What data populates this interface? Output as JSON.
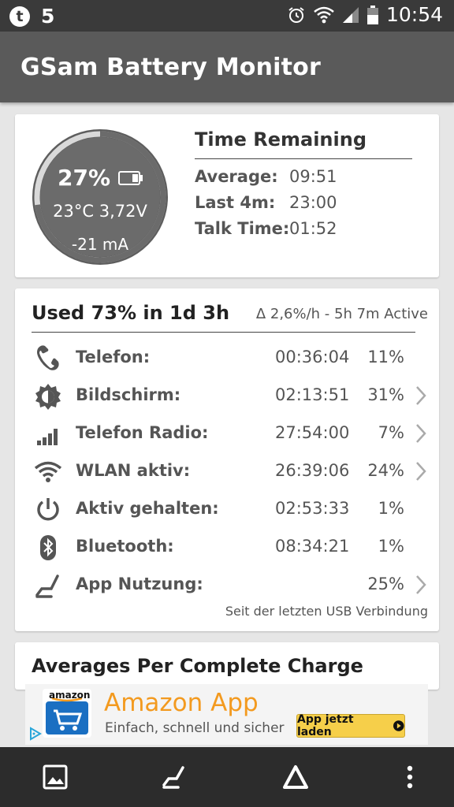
{
  "status_bar": {
    "left_icon": "t",
    "notification_count": "5",
    "time": "10:54",
    "icons": [
      "alarm-icon",
      "wifi-icon",
      "signal-icon",
      "battery-icon"
    ]
  },
  "app_bar": {
    "title": "GSam Battery Monitor"
  },
  "gauge": {
    "percent": "27%",
    "level": 0.27,
    "temp_voltage": "23°C  3,72V",
    "current": "-21 mA"
  },
  "time_remaining": {
    "title": "Time Remaining",
    "rows": [
      {
        "label": "Average:",
        "value": "09:51"
      },
      {
        "label": "Last 4m:",
        "value": "23:00"
      },
      {
        "label": "Talk Time:",
        "value": "01:52"
      }
    ]
  },
  "usage": {
    "title": "Used 73% in 1d 3h",
    "rate": "Δ 2,6%/h - 5h 7m Active",
    "rows": [
      {
        "icon": "phone-icon",
        "label": "Telefon:",
        "time": "00:36:04",
        "percent": "11%",
        "has_chevron": false
      },
      {
        "icon": "brightness-icon",
        "label": "Bildschirm:",
        "time": "02:13:51",
        "percent": "31%",
        "has_chevron": true
      },
      {
        "icon": "signal-bars-icon",
        "label": "Telefon Radio:",
        "time": "27:54:00",
        "percent": "7%",
        "has_chevron": true
      },
      {
        "icon": "wifi-icon",
        "label": "WLAN aktiv:",
        "time": "26:39:06",
        "percent": "24%",
        "has_chevron": true
      },
      {
        "icon": "power-icon",
        "label": "Aktiv gehalten:",
        "time": "02:53:33",
        "percent": "1%",
        "has_chevron": false
      },
      {
        "icon": "bluetooth-icon",
        "label": "Bluetooth:",
        "time": "08:34:21",
        "percent": "1%",
        "has_chevron": false
      },
      {
        "icon": "app-usage-icon",
        "label": "App Nutzung:",
        "time": "",
        "percent": "25%",
        "has_chevron": true
      }
    ],
    "since": "Seit der letzten USB Verbindung"
  },
  "averages": {
    "title": "Averages Per Complete Charge"
  },
  "ad": {
    "brand": "amazon",
    "title": "Amazon App",
    "subtitle": "Einfach, schnell und sicher",
    "button": "App jetzt laden"
  },
  "bottom_nav": [
    "image-icon",
    "app-usage-icon",
    "delta-icon",
    "overflow-menu-icon"
  ],
  "colors": {
    "status_bar": "#3a3a3a",
    "app_bar": "#5a5a5a",
    "gauge_fill": "#6b6b6b",
    "gauge_ring": "#d9d9d9",
    "ad_orange": "#f39a1f",
    "ad_button": "#f6cf4a",
    "bottom_bar": "#2c2c2c"
  }
}
